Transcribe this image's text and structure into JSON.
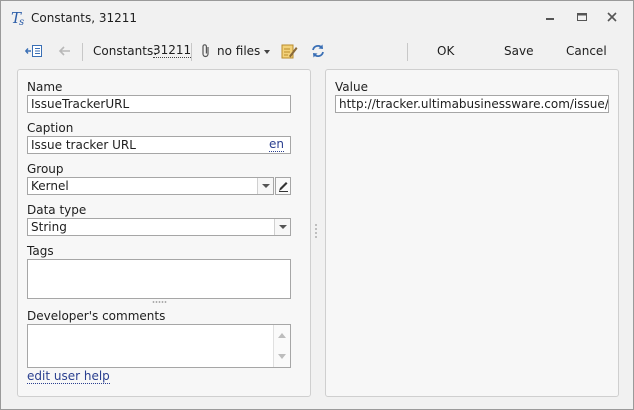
{
  "window": {
    "title": "Constants, 31211",
    "icons": {
      "app": "formula-icon",
      "minimize": "minimize-icon",
      "maximize": "maximize-icon",
      "close": "close-icon"
    }
  },
  "toolbar": {
    "constants_label": "Constants:",
    "record_id": "31211",
    "files_label": "no files",
    "ok_label": "OK",
    "save_label": "Save",
    "cancel_label": "Cancel",
    "icons": [
      "panel-toggle-icon",
      "back-arrow-icon",
      "paperclip-icon",
      "dropdown-arrow-icon",
      "edit-note-icon",
      "refresh-icon"
    ]
  },
  "form": {
    "name": {
      "label": "Name",
      "value": "IssueTrackerURL"
    },
    "caption": {
      "label": "Caption",
      "value": "Issue tracker URL",
      "lang": "en"
    },
    "group": {
      "label": "Group",
      "value": "Kernel"
    },
    "data_type": {
      "label": "Data type",
      "value": "String"
    },
    "tags": {
      "label": "Tags",
      "value": ""
    },
    "dev_comments": {
      "label": "Developer's comments",
      "value": ""
    },
    "help_link": "edit user help"
  },
  "value_panel": {
    "label": "Value",
    "value": "http://tracker.ultimabusinessware.com/issue/{IssueId}"
  },
  "colors": {
    "accent_blue": "#3a6fb5",
    "link": "#2a3f8f",
    "window_bg": "#f1f1f1"
  }
}
